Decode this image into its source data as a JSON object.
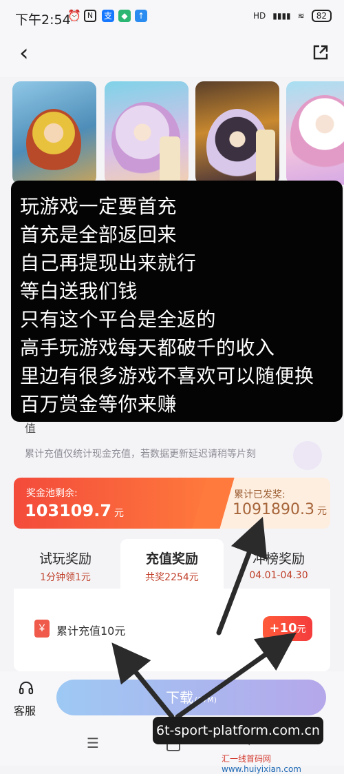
{
  "status_bar": {
    "time": "下午2:54",
    "network": "HD",
    "battery": "82",
    "app_icons": [
      "alarm-icon",
      "nfc-icon",
      "alipay-icon",
      "shield-icon",
      "upload-icon"
    ]
  },
  "header": {
    "back_icon": "back-arrow-icon",
    "share_icon": "share-icon"
  },
  "banners": [
    {
      "name": "game-banner-1",
      "tag": ""
    },
    {
      "name": "game-banner-2",
      "tag": ""
    },
    {
      "name": "game-banner-3",
      "tag": ""
    },
    {
      "name": "game-banner-4",
      "tag": ""
    }
  ],
  "overlay_text": [
    "玩游戏一定要首充",
    "首充是全部返回来",
    "自己再提现出来就行",
    "等白送我们钱",
    "只有这个平台是全返的",
    "高手玩游戏每天都破千的收入",
    "里边有很多游戏不喜欢可以随便换",
    "百万赏金等你来赚"
  ],
  "partial_label": "值",
  "note": "累计充值仅统计现金充值，若数据更新延迟请稍等片刻",
  "pool": {
    "left_label": "奖金池剩余:",
    "left_value": "103109.7",
    "left_unit": "元",
    "right_label": "累计已发奖:",
    "right_value": "1091890.3",
    "right_unit": "元"
  },
  "tabs": [
    {
      "title": "试玩奖励",
      "sub": "1分钟领1元"
    },
    {
      "title": "充值奖励",
      "sub": "共奖2254元"
    },
    {
      "title": "冲榜奖励",
      "sub": "04.01-04.30"
    }
  ],
  "reward_item": {
    "icon": "gift-icon",
    "icon_glyph": "￥",
    "label": "累计充值10元",
    "badge": "+10",
    "badge_unit": "元"
  },
  "bottom": {
    "cs_label": "客服",
    "download_label": "下载",
    "download_size": "(17M)"
  },
  "watermarks": {
    "domain": "6t-sport-platform.com.cn",
    "site_prefix": "汇一线首码网",
    "site_url": "www.huiyixian.com"
  },
  "colors": {
    "accent_red": "#f34b3b",
    "accent_orange": "#ff7a3c",
    "download_gradient_start": "#9ec9f4",
    "download_gradient_end": "#b5a7ea"
  }
}
